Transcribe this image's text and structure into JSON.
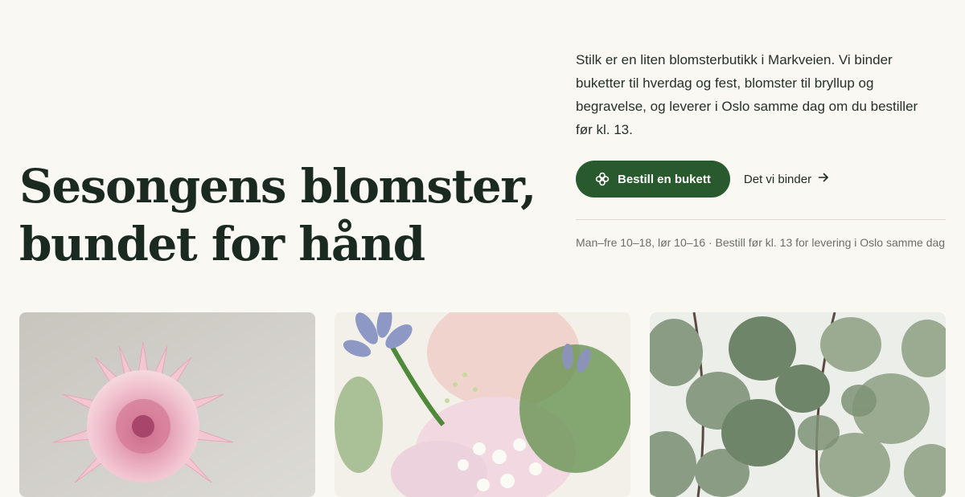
{
  "hero": {
    "title_line1": "Sesongens blomster,",
    "title_line2": "bundet for hånd"
  },
  "intro": {
    "text": "Stilk er en liten blomsterbutikk i Markveien. Vi binder buketter til hverdag og fest, blomster til bryllup og begravelse, og leverer i Oslo samme dag om du bestiller før kl. 13."
  },
  "cta": {
    "primary_label": "Bestill en bukett",
    "primary_icon": "flower-icon",
    "secondary_label": "Det vi binder",
    "secondary_icon": "arrow-right-icon"
  },
  "info": {
    "hours": "Man–fre 10–18, lør 10–16 · Bestill før kl. 13 for levering i Oslo samme dag"
  },
  "gallery": {
    "images": [
      "dahlia-photo",
      "bouquet-photo",
      "eucalyptus-photo"
    ]
  },
  "colors": {
    "background": "#faf8f3",
    "accent": "#285a2e",
    "heading": "#1b2a20",
    "muted": "#6b6e68"
  }
}
